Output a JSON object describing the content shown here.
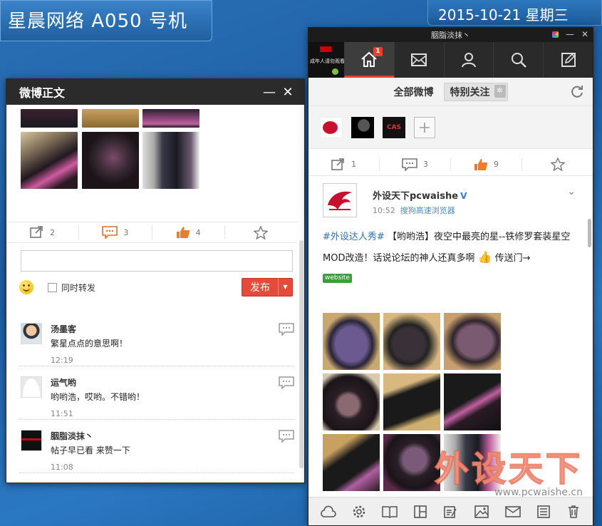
{
  "desktop": {
    "machine_label": "星晨网络 A050 号机",
    "date_label": "2015-10-21 星期三"
  },
  "left_window": {
    "title": "微博正文",
    "minimize": "—",
    "close": "✕",
    "actions": {
      "repost": "2",
      "comment": "3",
      "like": "4"
    },
    "input_placeholder": "",
    "also_repost_label": "同时转发",
    "publish_label": "发布",
    "comments": [
      {
        "name": "汤墨客",
        "text": "繁星点点的意思啊！",
        "time": "12:19"
      },
      {
        "name": "运气哟",
        "text": "哟哟浩，哎哟。不错哟！",
        "time": "11:51"
      },
      {
        "name": "胭脂淡抹丶",
        "text": "帖子早已看 来赞一下",
        "time": "11:08"
      }
    ]
  },
  "right_window": {
    "title": "胭脂淡抹丶",
    "avatar_text": "成年人请勿观看",
    "home_badge": "1",
    "filter": {
      "all": "全部微博",
      "special": "特别关注"
    },
    "actions": {
      "repost": "1",
      "comment": "3",
      "like": "9"
    },
    "post": {
      "author": "外设天下pcwaishe",
      "verified_mark": "V",
      "time": "10:52",
      "source": "搜狗高速浏览器",
      "topic": "#外设达人秀#",
      "text": "【哟哟浩】夜空中最亮的星--铁修罗套装星空MOD改造！话说论坛的神人还真多啊",
      "tail": "传送门→",
      "link_label": "website"
    },
    "watermark": {
      "cn": "外设天下",
      "url": "www.pcwaishe.cn"
    }
  }
}
